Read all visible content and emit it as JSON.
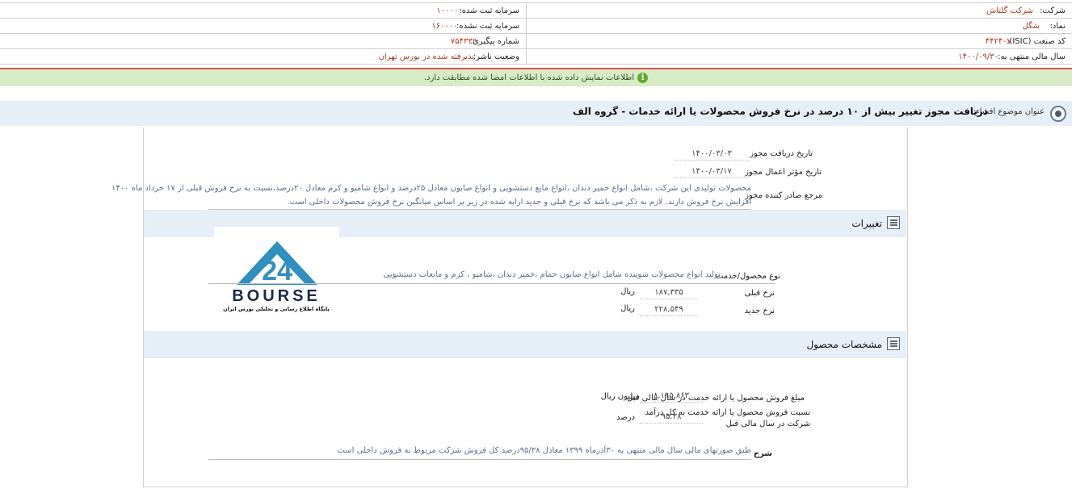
{
  "header": {
    "company_label": "شرکت:",
    "company_value": "شرکت گلتاش",
    "symbol_label": "نماد:",
    "symbol_value": "شگل",
    "isic_label": "کد صنعت (ISIC):",
    "isic_value": "۴۴۲۴۰۷",
    "fiscal_label": "سال مالی منتهی به:",
    "fiscal_value": "۱۴۰۰/۰۹/۳۰",
    "reg_capital_label": "سرمایه ثبت شده:",
    "reg_capital_value": "۱۰۰۰۰۰۰",
    "unreg_capital_label": "سرمایه ثبت نشده:",
    "unreg_capital_value": "۱۶۰۰۰۰۰",
    "tracking_label": "شماره پیگیری:",
    "tracking_value": "۷۵۴۳۲۲",
    "status_label": "وضعیت ناشر:",
    "status_value": "پذیرفته شده در بورس تهران"
  },
  "notice": {
    "text": "اطلاعات نمایش داده شده با اطلاعات امضا شده مطابقت دارد."
  },
  "title": {
    "label": "عنوان موضوع افشاء:",
    "text": "دریافت مجوز تغییر بیش از ۱۰ درصد در نرخ فروش محصولات یا ارائه خدمات - گروه الف"
  },
  "permit": {
    "receive_date_label": "تاریخ دریافت مجوز",
    "receive_date_value": "۱۴۰۰/۰۳/۰۳",
    "effective_date_label": "تاریخ مؤثر اعمال مجوز",
    "effective_date_value": "۱۴۰۰/۰۳/۱۷",
    "issuer_label": "مرجع صادر کننده مجوز",
    "issuer_line1": "محصولات تولیدی این شرکت ،شامل انواع خمیر دندان ،انواع مایع دستشویی و انواع صابون معادل ۲۵درصد و انواع شامپو و کرم معادل ۲۰درصد،نسبت به نرخ فروش قبلی از ۱۷ خرداد ماه ۱۴۰۰",
    "issuer_line2": "افزایش نرخ فروش دارند. لازم به ذکر می باشد که نرخ قبلی و جدید ارایه شده در زیر بر اساس میانگین نرخ فروش محصولات داخلی است."
  },
  "changes": {
    "section_title": "تغییرات",
    "product_label": "نوع محصول/خدمت",
    "product_value": "تولید انواع محصولات شوینده شامل انواع صابون حمام ،خمیر دندان ،شامپو ، کرم و مایعات دستشویی",
    "old_rate_label": "نرخ قبلی",
    "old_rate_value": "۱۸۷,۳۳۵",
    "old_rate_unit": "ریال",
    "new_rate_label": "نرخ جدید",
    "new_rate_value": "۲۲۸,۵۴۹",
    "new_rate_unit": "ریال"
  },
  "logo": {
    "brand": "BOURSE",
    "number": "24",
    "subtitle": "پایگاه اطلاع رسانی و تحلیلی بورس ایران"
  },
  "product": {
    "section_title": "مشخصات محصول",
    "sales_label": "مبلغ فروش محصول یا ارائه خدمت در سال مالی قبل",
    "sales_value": "۸,۱۹۵,۸۶۳",
    "sales_unit": "میلیون ریال",
    "ratio_label_1": "نسبت فروش محصول یا ارائه خدمت به کل درآمد",
    "ratio_label_2": "شرکت در سال مالی قبل",
    "ratio_value": "۹۵.۳۸",
    "ratio_unit": "درصد",
    "desc_label": "شرح",
    "desc_value": "طبق صورتهای مالی سال مالی منتهی به ۳۰آذرماه ۱۳۹۹ معادل ۹۵/۳۸درصد کل فروش شرکت مربوط به فروش داخلی است"
  },
  "colors": {
    "value_red": "#b23a1e",
    "notice_green": "#d7ebc6",
    "section_blue": "#e6eef7",
    "logo_blue": "#2f8fbf"
  }
}
